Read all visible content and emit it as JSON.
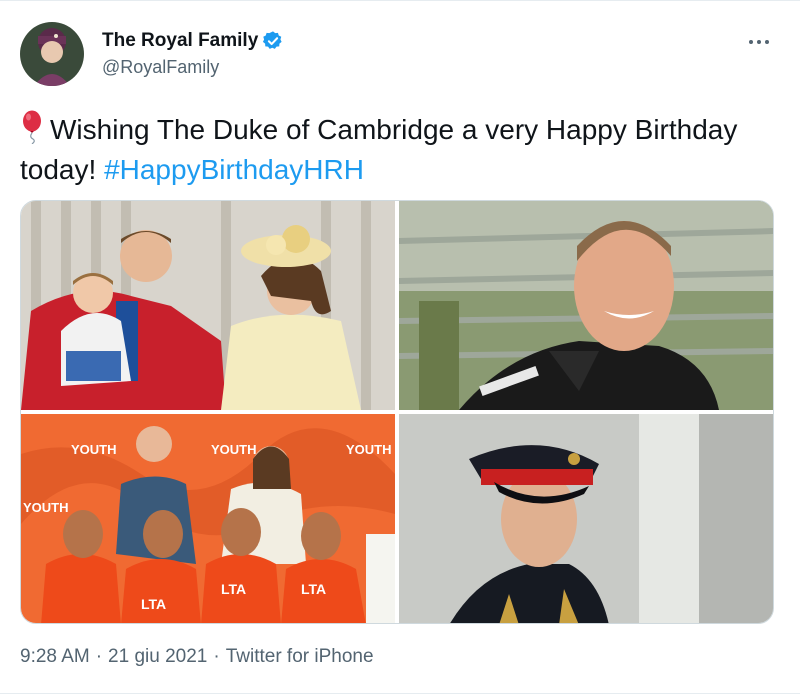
{
  "account": {
    "display_name": "The Royal Family",
    "handle": "@RoyalFamily",
    "verified_color": "#1d9bf0"
  },
  "tweet": {
    "text": "Wishing The Duke of Cambridge a very Happy Birthday today!",
    "hashtag": "#HappyBirthdayHRH",
    "emoji": "balloon-icon"
  },
  "meta": {
    "time": "9:28 AM",
    "separator": "·",
    "date": "21 giu 2021",
    "source": "Twitter for iPhone"
  },
  "photos": [
    {
      "subject": "family-balcony-photo"
    },
    {
      "subject": "racing-suit-portrait-photo"
    },
    {
      "subject": "youth-tennis-event-photo"
    },
    {
      "subject": "military-uniform-portrait-photo"
    }
  ],
  "colors": {
    "text": "#0f1419",
    "secondary": "#536471",
    "link": "#1d9bf0",
    "border": "#cfd9de"
  }
}
